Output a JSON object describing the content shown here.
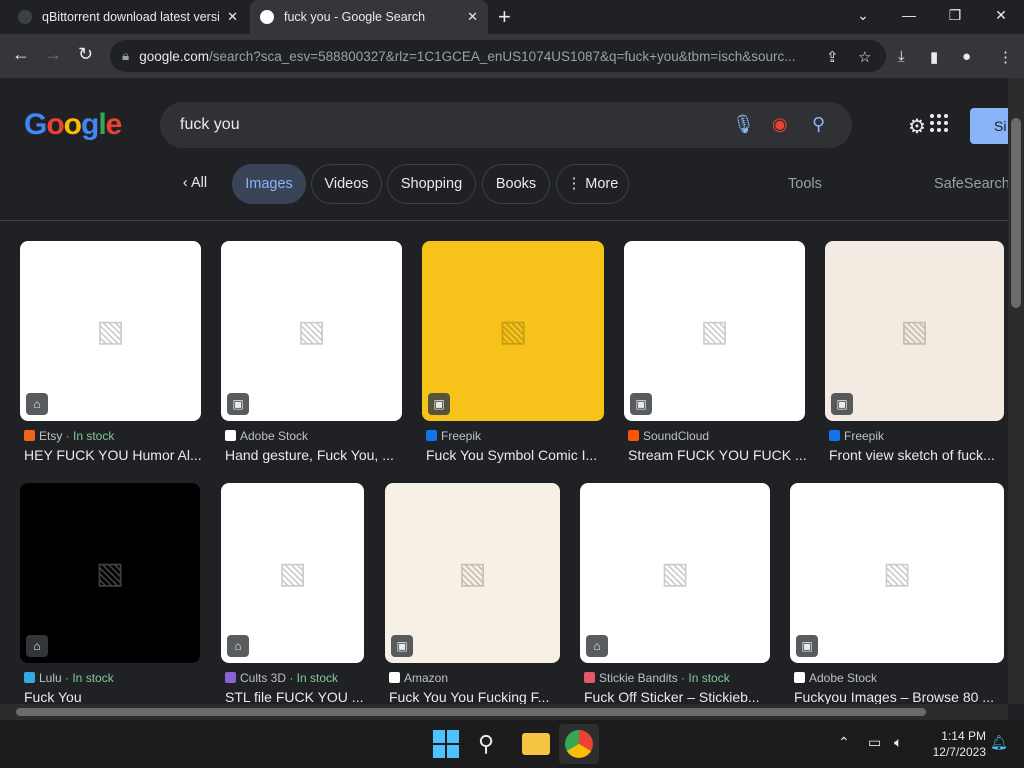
{
  "tabs": [
    {
      "title": "qBittorrent download latest version",
      "active": false
    },
    {
      "title": "fuck you - Google Search",
      "active": true
    }
  ],
  "address": {
    "host": "google.com",
    "path": "/search?sca_esv=588800327&rlz=1C1GCEA_enUS1074US1087&q=fuck+you&tbm=isch&sourc..."
  },
  "logo_text": "Google",
  "search": {
    "query": "fuck you"
  },
  "signin_label": "Si",
  "chips": [
    "All",
    "Images",
    "Videos",
    "Shopping",
    "Books",
    "More"
  ],
  "tools_label": "Tools",
  "safesearch_label": "SafeSearch",
  "row1": [
    {
      "source": "Etsy",
      "stock": "In stock",
      "title": "HEY FUCK YOU Humor Al...",
      "icon_color": "#f1641e",
      "bg": "#ffffff"
    },
    {
      "source": "Adobe Stock",
      "stock": "",
      "title": "Hand gesture, Fuck You, ...",
      "icon_color": "#ffffff",
      "bg": "#ffffff"
    },
    {
      "source": "Freepik",
      "stock": "",
      "title": "Fuck You Symbol Comic I...",
      "icon_color": "#1273eb",
      "bg": "#f7c31b"
    },
    {
      "source": "SoundCloud",
      "stock": "",
      "title": "Stream FUCK YOU FUCK ...",
      "icon_color": "#ff5500",
      "bg": "#ffffff"
    },
    {
      "source": "Freepik",
      "stock": "",
      "title": "Front view sketch of fuck...",
      "icon_color": "#1273eb",
      "bg": "#f3ebe1"
    }
  ],
  "row2": [
    {
      "source": "Lulu",
      "stock": "In stock",
      "title": "Fuck You",
      "icon_color": "#34a8e0",
      "bg": "#000000"
    },
    {
      "source": "Cults 3D",
      "stock": "In stock",
      "title": "STL file FUCK YOU ...",
      "icon_color": "#8a63d2",
      "bg": "#ffffff"
    },
    {
      "source": "Amazon",
      "stock": "",
      "title": "Fuck You You Fucking F...",
      "icon_color": "#ffffff",
      "bg": "#f6f1e4"
    },
    {
      "source": "Stickie Bandits",
      "stock": "In stock",
      "title": "Fuck Off Sticker – Stickieb...",
      "icon_color": "#e8566b",
      "bg": "#ffffff"
    },
    {
      "source": "Adobe Stock",
      "stock": "",
      "title": "Fuckyou Images – Browse 80 ...",
      "icon_color": "#ffffff",
      "bg": "#ffffff"
    }
  ],
  "clock": {
    "time": "1:14 PM",
    "date": "12/7/2023"
  }
}
